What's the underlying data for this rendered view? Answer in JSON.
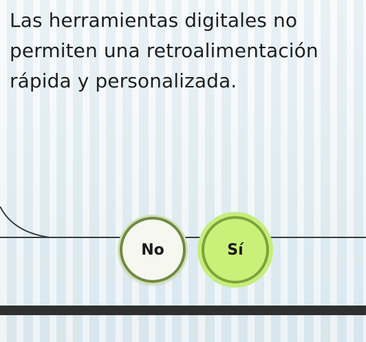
{
  "question": {
    "text": "Las herramientas digitales no permiten una retroalimentación rápida y personalizada."
  },
  "answers": {
    "no_label": "No",
    "si_label": "Sí",
    "selected": "Sí"
  },
  "colors": {
    "selected_fill": "#c9f17a",
    "selected_border": "#7ea33a",
    "unselected_fill": "#f6f7ef",
    "unselected_border": "#6f8b44"
  }
}
